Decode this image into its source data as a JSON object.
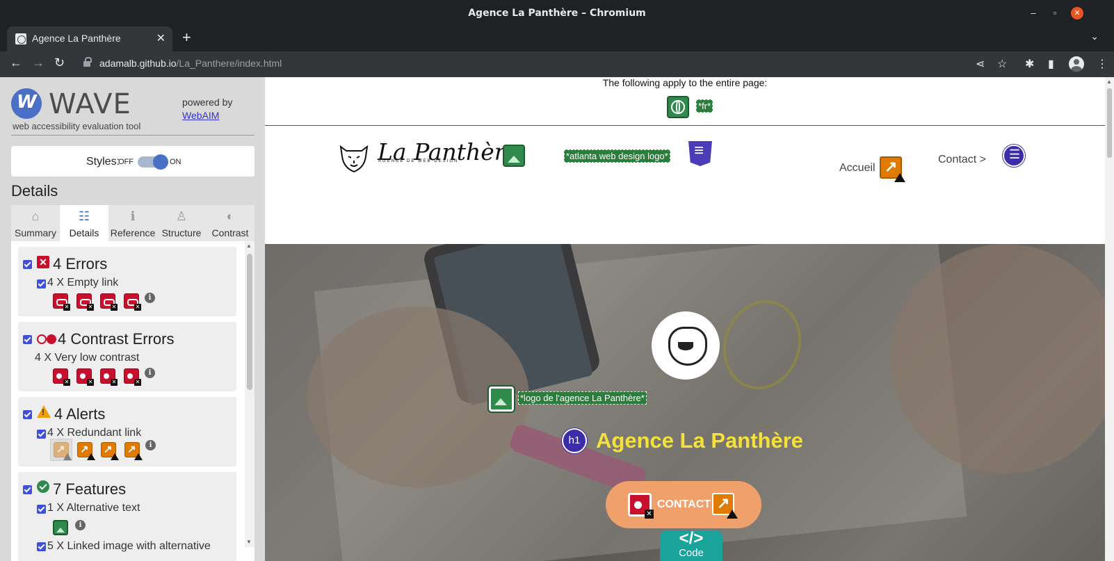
{
  "window": {
    "title": "Agence La Panthère – Chromium",
    "minimize_glyph": "–",
    "maximize_glyph": "▫",
    "close_glyph": "✕"
  },
  "tab": {
    "title": "Agence La Panthère",
    "close_glyph": "✕",
    "new_tab_glyph": "+",
    "menu_glyph": "⌄"
  },
  "address_bar": {
    "host": "adamalb.github.io",
    "path": "/La_Panthere/index.html"
  },
  "toolbar_glyphs": {
    "back": "←",
    "forward": "→",
    "reload": "↻",
    "share": "⋖",
    "star": "☆",
    "extensions": "✱",
    "sidepanel": "▮",
    "menu": "⋮"
  },
  "wave": {
    "logo_letter": "W",
    "name": "WAVE",
    "subtitle": "web accessibility evaluation tool",
    "powered_by": "powered by",
    "powered_link": "WebAIM",
    "styles_label": "Styles:",
    "styles_off": "OFF",
    "styles_on": "ON",
    "styles_state": "on",
    "details_heading": "Details",
    "tabs": [
      {
        "label": "Summary",
        "icon": "⌂"
      },
      {
        "label": "Details",
        "icon": "☷"
      },
      {
        "label": "Reference",
        "icon": "ℹ"
      },
      {
        "label": "Structure",
        "icon": "♙"
      },
      {
        "label": "Contrast",
        "icon": "◐"
      }
    ],
    "active_tab": "Details",
    "categories": {
      "errors": {
        "title": "4 Errors",
        "item": "4 X Empty link",
        "count": 4
      },
      "contrast": {
        "title": "4 Contrast Errors",
        "item": "4 X Very low contrast",
        "count": 4
      },
      "alerts": {
        "title": "4 Alerts",
        "item": "4 X Redundant link",
        "count": 4
      },
      "features": {
        "title": "7 Features",
        "item": "1 X Alternative text",
        "item2": "5 X Linked image with alternative"
      }
    },
    "info_glyph": "i",
    "x_glyph": "✕"
  },
  "page": {
    "applies_text": "The following apply to the entire page:",
    "lang_tag": "*fr*",
    "brand_name": "La Panthère",
    "brand_sub": "AGENCE DE WEB DESIGN",
    "logo_alt_tag": "*atlanta web design logo*",
    "nav": {
      "home": "Accueil",
      "contact": "Contact >"
    },
    "hero_logo_alt_tag": "*logo de l'agence La Panthère*",
    "h1_badge": "h1",
    "hero_title": "Agence La Panthère",
    "contact_button": "CONTACT",
    "code_tab": {
      "symbol": "</>",
      "label": "Code"
    }
  },
  "colors": {
    "wave_accent": "#4a6fc7",
    "error": "#c8102e",
    "alert": "#e07b00",
    "feature": "#2f8a4c",
    "structure": "#3b2ca8",
    "hero_title": "#f5e13a",
    "contact_button": "#f0a06b",
    "code_tab": "#1aa39a"
  }
}
